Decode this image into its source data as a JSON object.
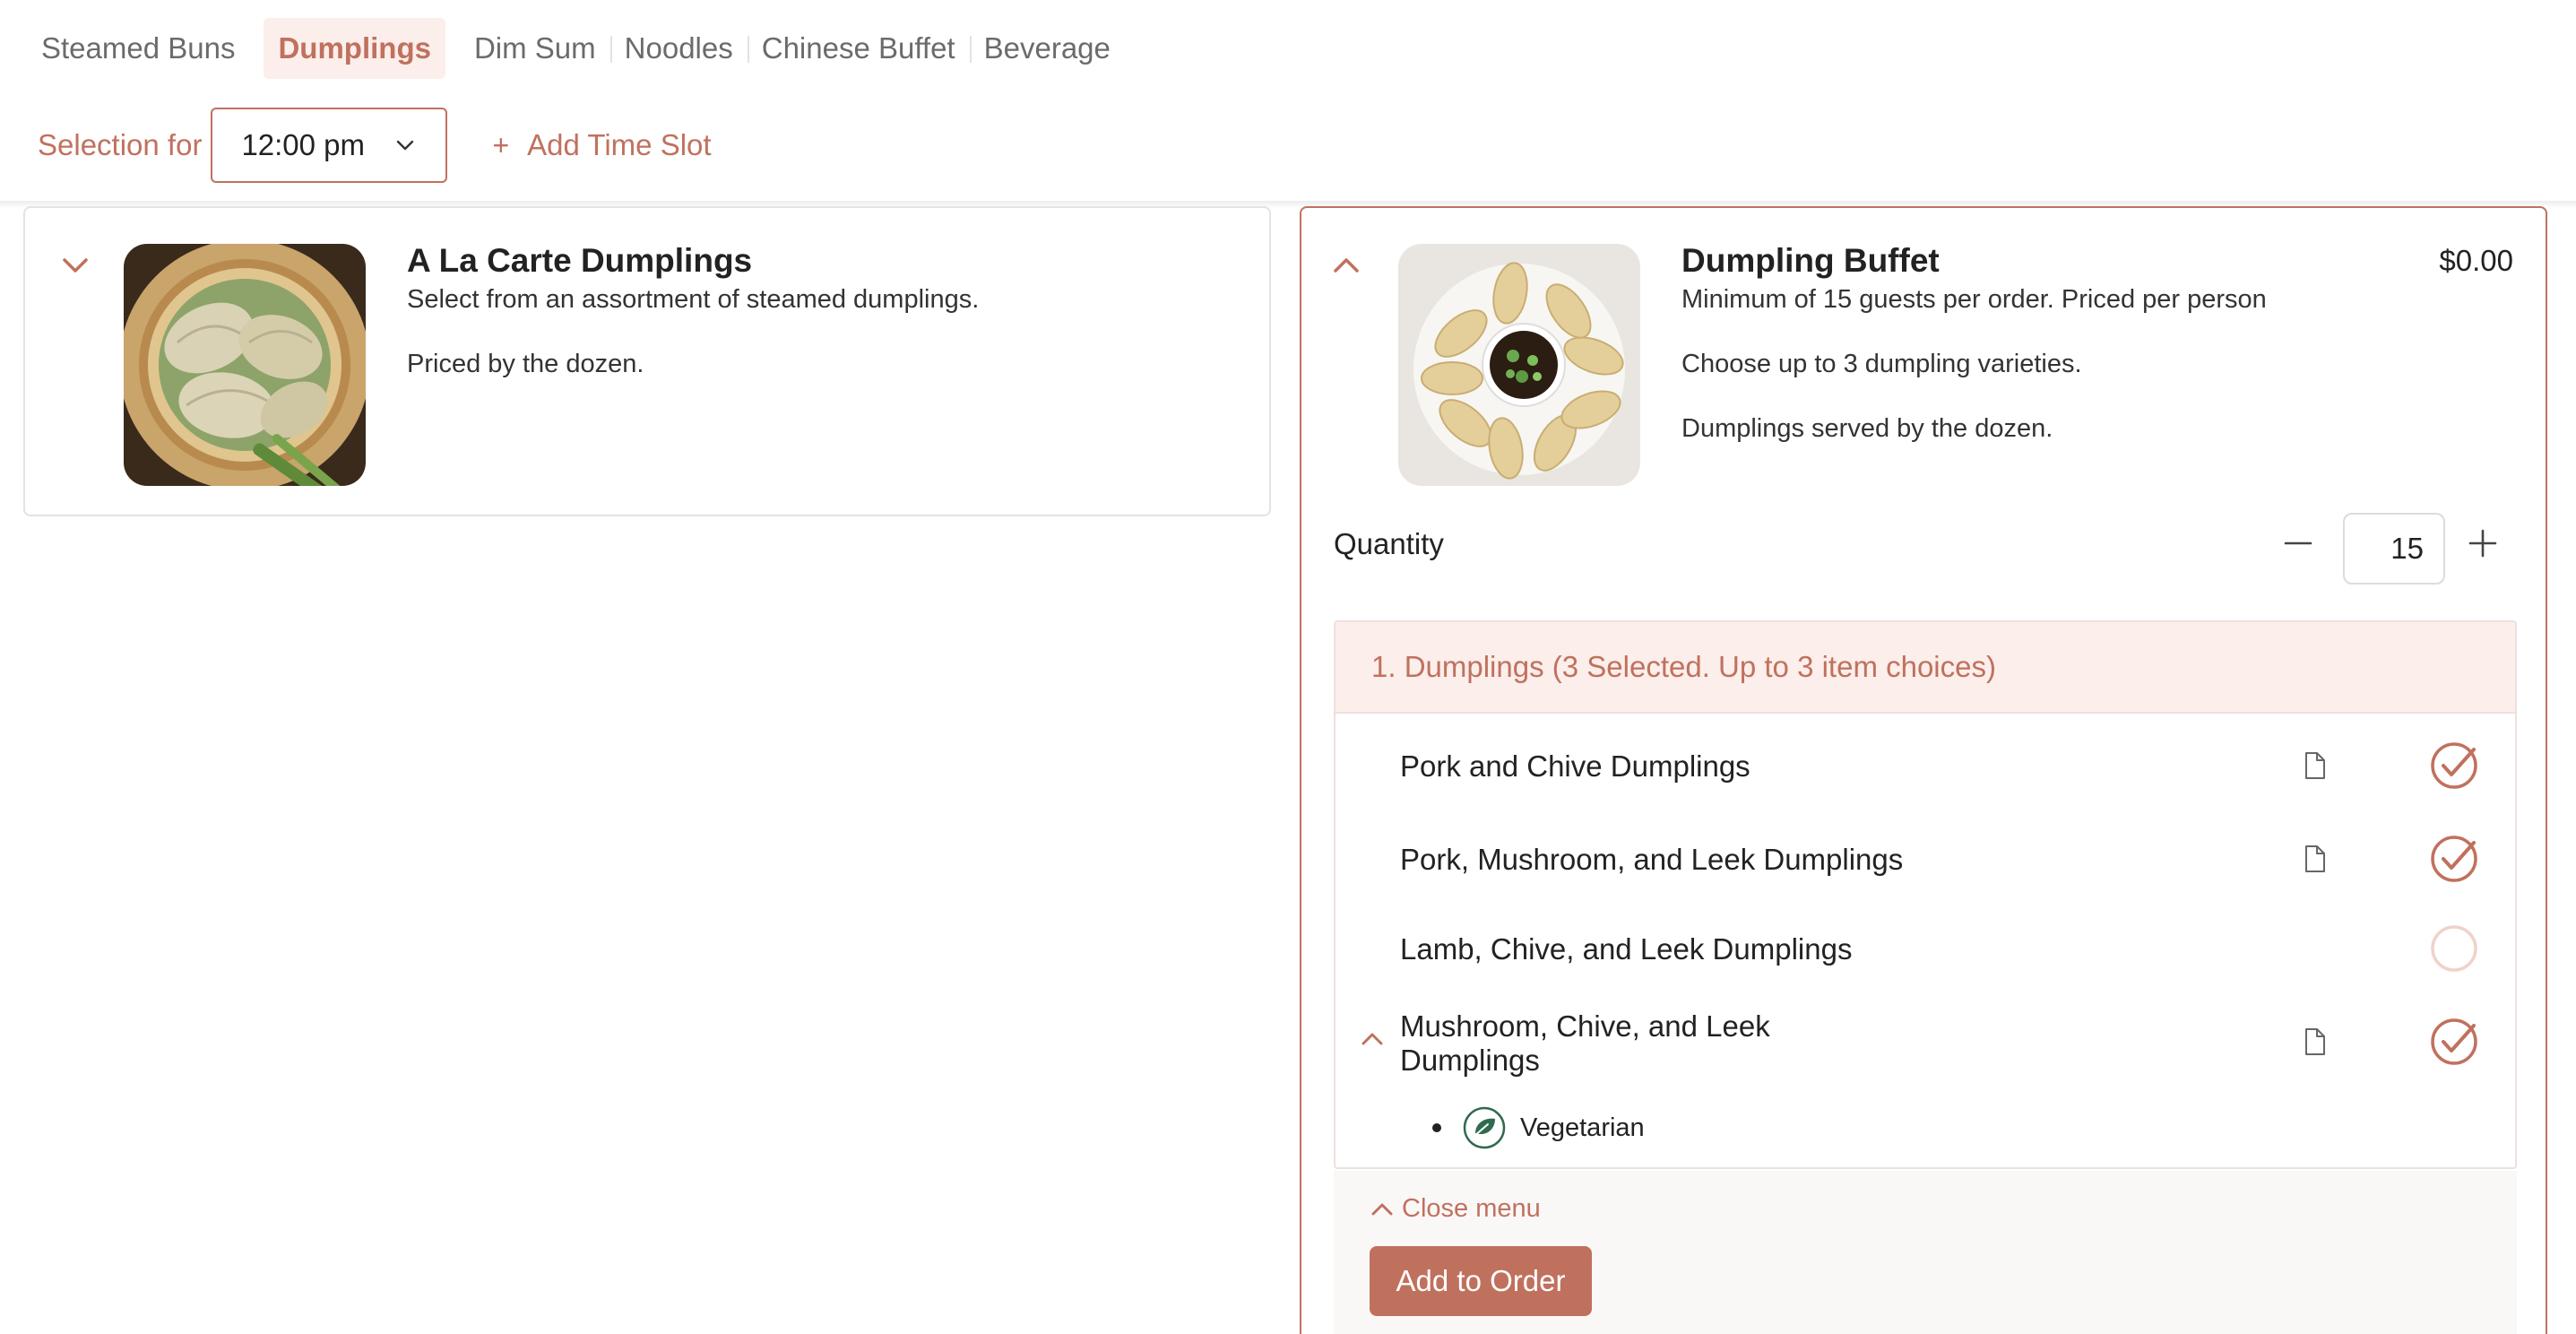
{
  "tabs": [
    {
      "label": "Steamed Buns"
    },
    {
      "label": "Dumplings"
    },
    {
      "label": "Dim Sum"
    },
    {
      "label": "Noodles"
    },
    {
      "label": "Chinese Buffet"
    },
    {
      "label": "Beverage"
    }
  ],
  "active_tab": "Dumplings",
  "selection": {
    "label": "Selection for",
    "time_value": "12:00 pm",
    "add_slot_label": "Add Time Slot",
    "add_slot_icon": "plus-icon"
  },
  "items": [
    {
      "title": "A La Carte Dumplings",
      "desc_line1": "Select from an assortment of steamed dumplings.",
      "desc_line2": "Priced by the dozen.",
      "expanded": false,
      "toggle_icon": "chevron-down-icon"
    },
    {
      "title": "Dumpling Buffet",
      "price": "$0.00",
      "desc_line1": "Minimum of 15 guests per order. Priced per person",
      "desc_line2": "Choose up to 3 dumpling varieties.",
      "desc_line3": "Dumplings served by the dozen.",
      "expanded": true,
      "toggle_icon": "chevron-up-icon",
      "quantity_label": "Quantity",
      "quantity_value": "15",
      "group": {
        "header": "1. Dumplings  (3 Selected. Up to 3 item choices)",
        "options": [
          {
            "name": "Pork and Chive Dumplings",
            "selected": true,
            "has_details": true
          },
          {
            "name": "Pork, Mushroom, and Leek Dumplings",
            "selected": true,
            "has_details": true
          },
          {
            "name": "Lamb, Chive, and Leek Dumplings",
            "selected": false,
            "has_details": false
          },
          {
            "name_line1": "Mushroom, Chive, and Leek",
            "name_line2": "Dumplings",
            "selected": true,
            "has_details": true,
            "expanded": true,
            "tags": [
              "Vegetarian"
            ]
          }
        ]
      },
      "close_menu_label": "Close menu",
      "add_to_order_label": "Add to Order"
    }
  ],
  "colors": {
    "accent": "#c0715e",
    "accent_light": "#fbeeeb",
    "vegetarian": "#2f6b4f"
  }
}
